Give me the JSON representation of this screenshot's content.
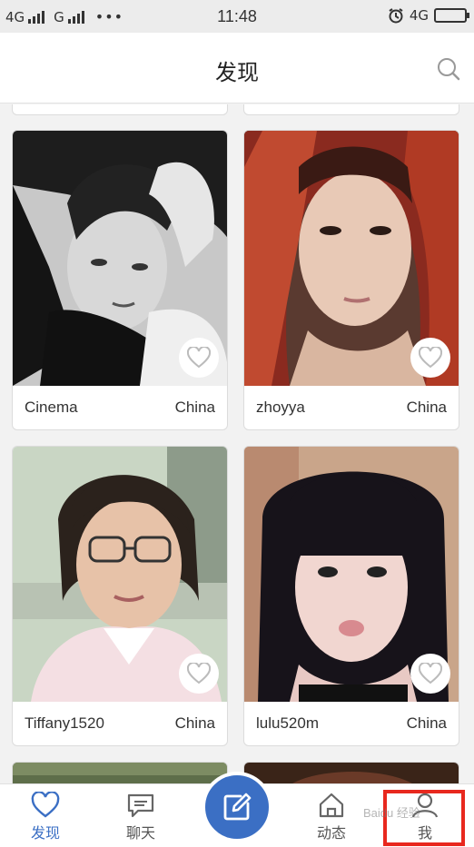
{
  "status_bar": {
    "network1": "4G",
    "network2": "G",
    "network3": "4G",
    "more": "•••",
    "time": "11:48",
    "icons": [
      "alarm-icon",
      "battery-icon"
    ]
  },
  "header": {
    "title": "发现",
    "search_icon": "search-icon"
  },
  "cards": [
    {
      "name": "Cinema",
      "location": "China"
    },
    {
      "name": "zhoyya",
      "location": "China"
    },
    {
      "name": "Tiffany1520",
      "location": "China"
    },
    {
      "name": "lulu520m",
      "location": "China"
    }
  ],
  "tabbar": {
    "tabs": [
      {
        "label": "发现",
        "icon": "heart-icon",
        "active": true
      },
      {
        "label": "聊天",
        "icon": "chat-icon",
        "active": false
      },
      {
        "label": "动态",
        "icon": "home-icon",
        "active": false
      },
      {
        "label": "我",
        "icon": "person-icon",
        "active": false
      }
    ],
    "compose_icon": "compose-icon"
  },
  "watermark": "Baidu 经验",
  "colors": {
    "accent": "#3b6fc4",
    "highlight": "#e8281e",
    "background": "#f2f2f2"
  }
}
